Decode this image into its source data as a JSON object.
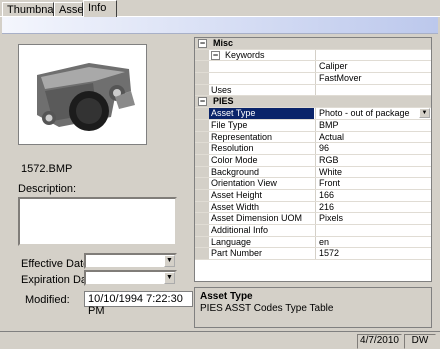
{
  "tabs": [
    {
      "label": "Thumbnails"
    },
    {
      "label": "Asset"
    },
    {
      "label": "Info"
    }
  ],
  "left": {
    "filename": "1572.BMP",
    "description_label": "Description:",
    "description_value": "",
    "effective_label": "Effective Date:",
    "expiration_label": "Expiration Date:",
    "modified_label": "Modified:",
    "modified_value": "10/10/1994 7:22:30 PM"
  },
  "grid": {
    "misc": "Misc",
    "keywords": "Keywords",
    "keyword_values": [
      "Caliper",
      "FastMover"
    ],
    "uses": "Uses",
    "pies": "PIES",
    "props": [
      {
        "k": "Asset Type",
        "v": "Photo - out of package"
      },
      {
        "k": "File Type",
        "v": "BMP"
      },
      {
        "k": "Representation",
        "v": "Actual"
      },
      {
        "k": "Resolution",
        "v": "96"
      },
      {
        "k": "Color Mode",
        "v": "RGB"
      },
      {
        "k": "Background",
        "v": "White"
      },
      {
        "k": "Orientation View",
        "v": "Front"
      },
      {
        "k": "Asset Height",
        "v": "166"
      },
      {
        "k": "Asset Width",
        "v": "216"
      },
      {
        "k": "Asset Dimension UOM",
        "v": "Pixels"
      },
      {
        "k": "Additional Info",
        "v": ""
      },
      {
        "k": "Language",
        "v": "en"
      },
      {
        "k": "Part Number",
        "v": "1572"
      }
    ]
  },
  "help": {
    "title": "Asset Type",
    "description": "PIES ASST Codes Type Table"
  },
  "status": {
    "date": "4/7/2010",
    "user": "DW"
  }
}
